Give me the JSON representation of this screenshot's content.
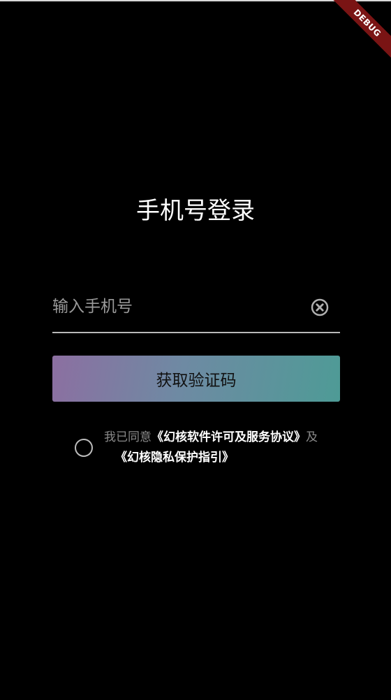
{
  "debug_banner": {
    "label": "DEBUG"
  },
  "login": {
    "title": "手机号登录",
    "phone_placeholder": "输入手机号",
    "clear_icon": "clear-circle-icon",
    "get_code_label": "获取验证码"
  },
  "agreement": {
    "prefix": "我已同意",
    "license_link": "《幻核软件许可及服务协议》",
    "conjunction": "及",
    "privacy_link": "《幻核隐私保护指引》"
  },
  "colors": {
    "background": "#000000",
    "gradient_start": "#8c6fa1",
    "gradient_end": "#4e9b96",
    "debug_ribbon": "#7a1414"
  }
}
